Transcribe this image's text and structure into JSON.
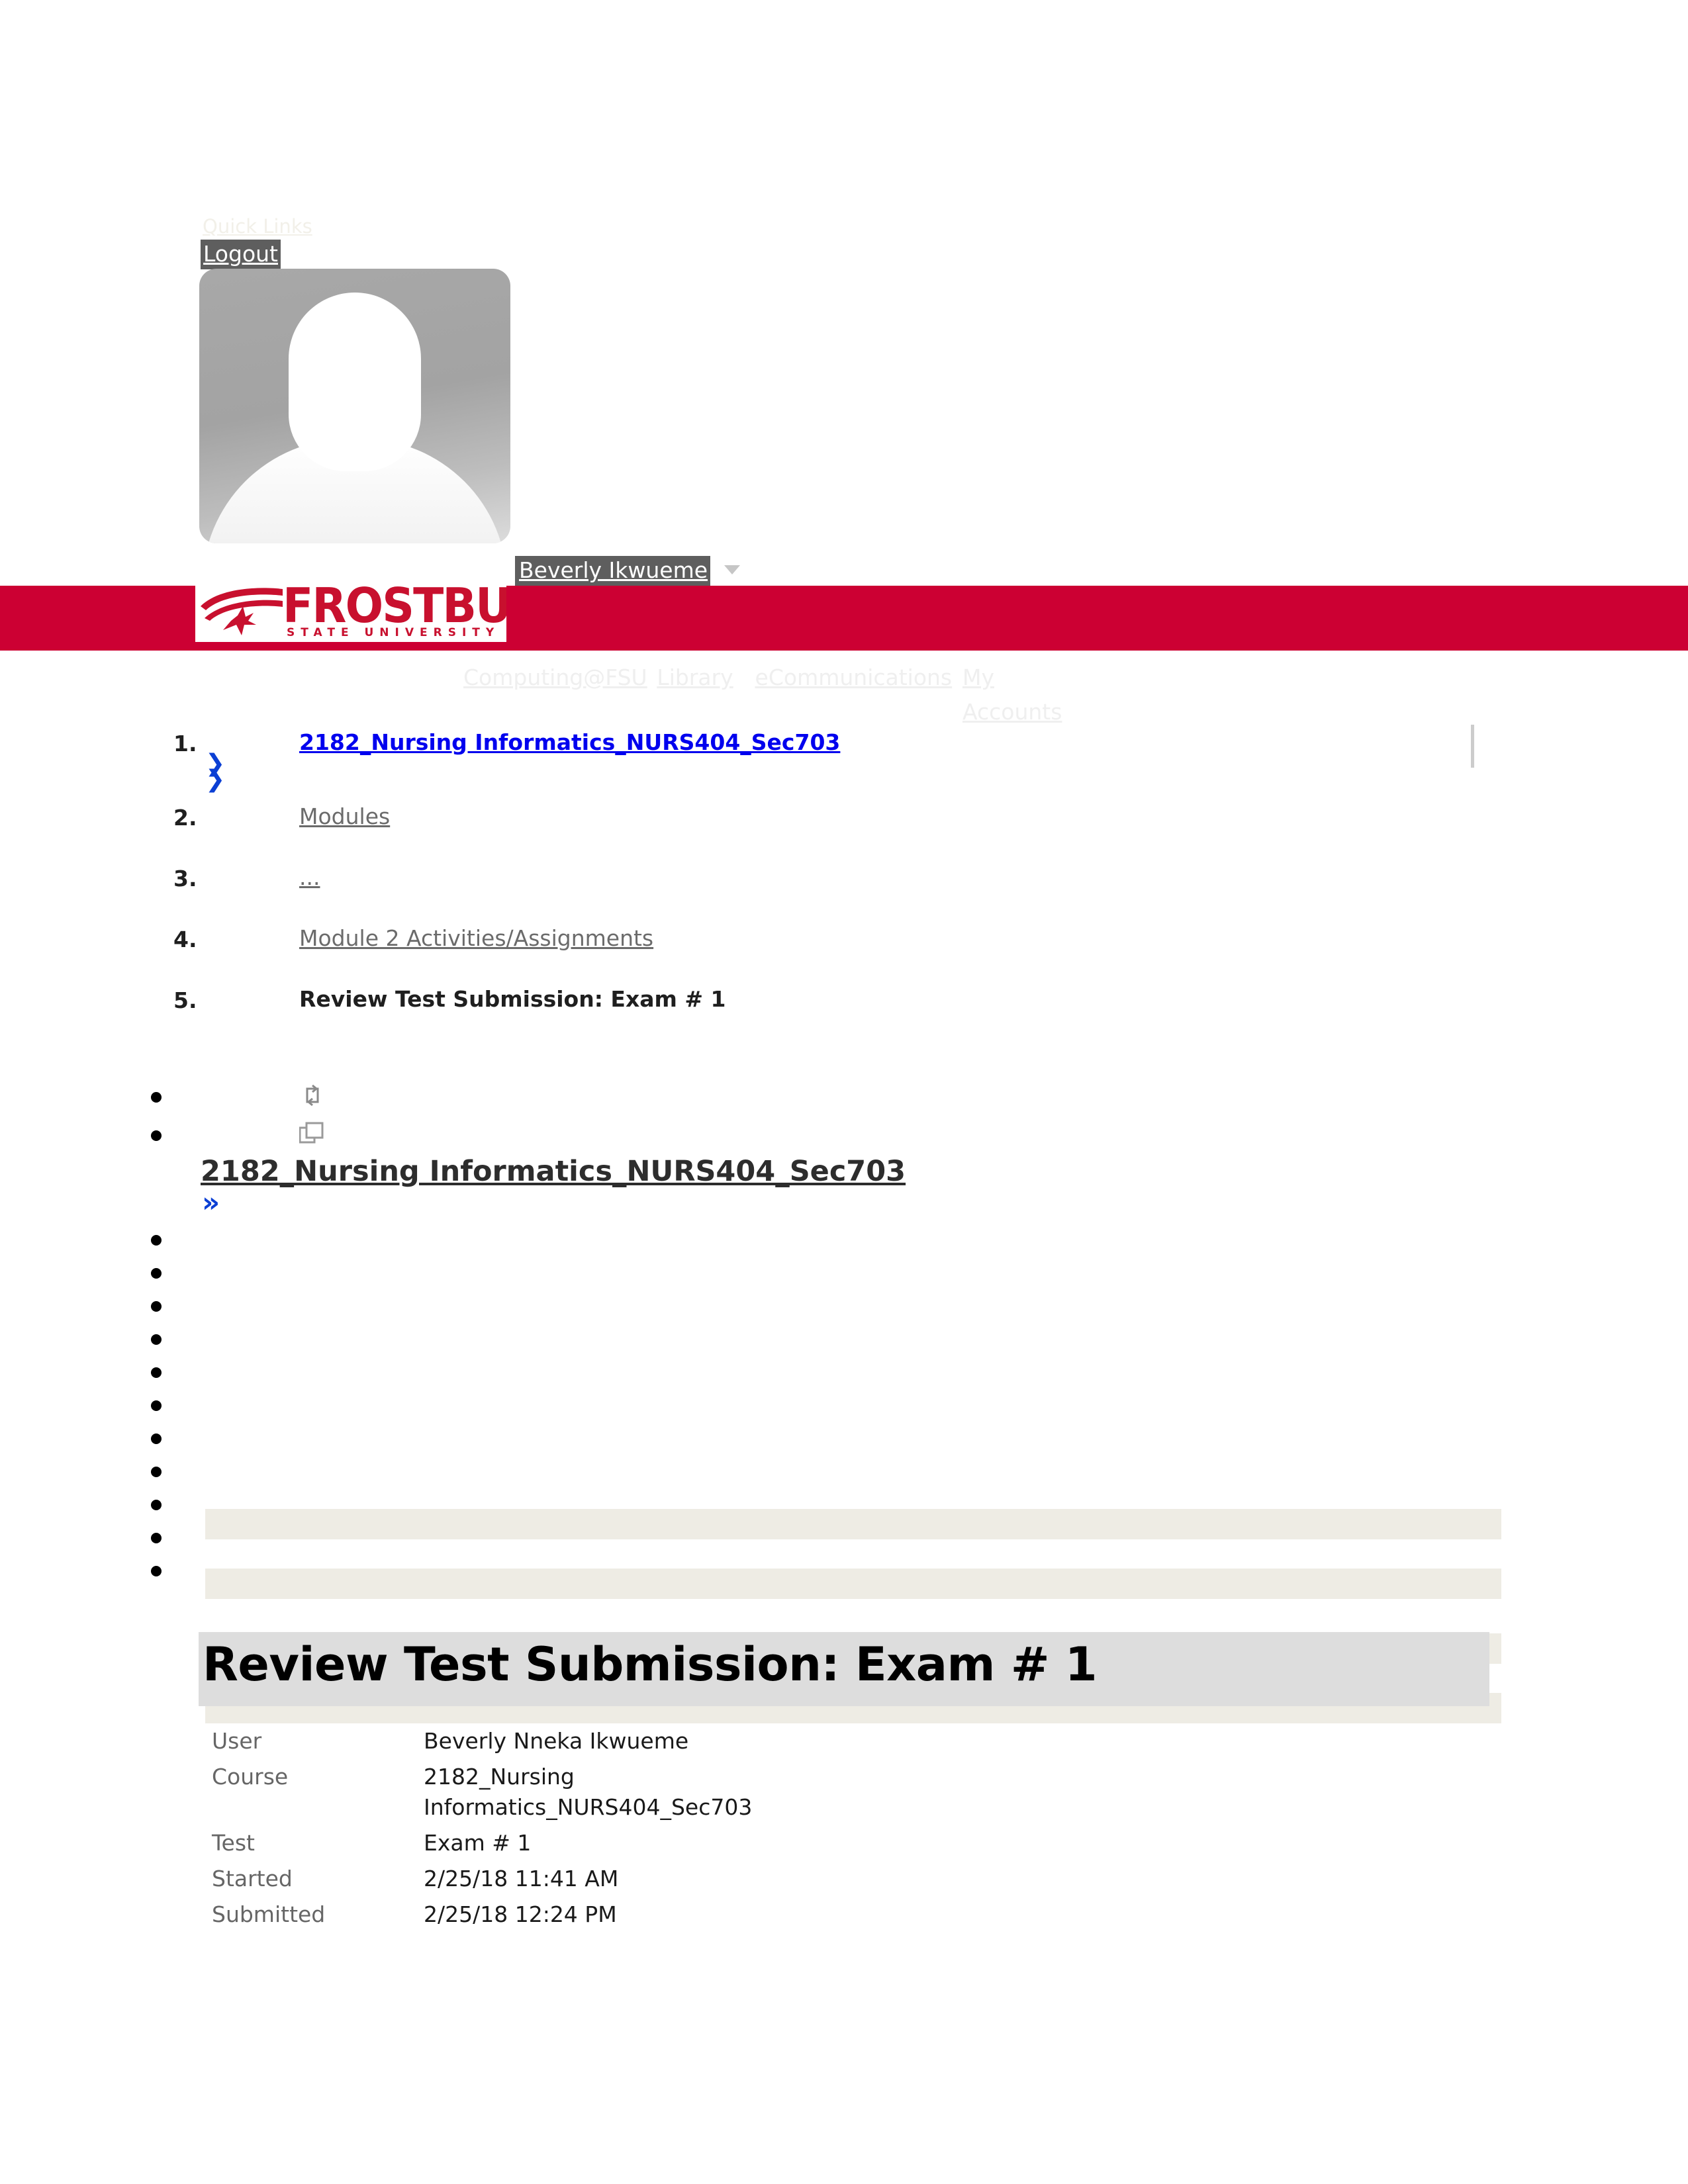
{
  "colors": {
    "brand_red": "#cc0033",
    "link_blue": "#0000ee",
    "chevron_blue": "#0b3fd4",
    "breadcrumb_sep": "#eeece4",
    "header_gray": "#dddddd",
    "pill_gray": "#5e5e5e"
  },
  "quick_links": {
    "label": "Quick Links",
    "logout_label": "Logout"
  },
  "user_menu": {
    "name": "Beverly Ikwueme",
    "caret_icon": "chevron-down-icon",
    "avatar_icon": "user-avatar-placeholder-icon"
  },
  "brand": {
    "wordmark": "FROSTBURG",
    "subwordmark": "STATE UNIVERSITY",
    "logo_icon": "frostburg-bobcat-logo-icon"
  },
  "top_nav": {
    "items": [
      {
        "label": "Computing@FSU"
      },
      {
        "label": "Library"
      },
      {
        "label": "eCommunications"
      },
      {
        "label": "My Accounts"
      }
    ]
  },
  "breadcrumb": {
    "items": [
      {
        "number": "1.",
        "label": "2182_Nursing Informatics_NURS404_Sec703",
        "style": "first"
      },
      {
        "number": "2.",
        "label": "Modules",
        "style": "link"
      },
      {
        "number": "3.",
        "label": "...",
        "style": "link"
      },
      {
        "number": "4.",
        "label": "Module 2 Activities/Assignments",
        "style": "link"
      },
      {
        "number": "5.",
        "label": "Review Test Submission: Exam # 1",
        "style": "current"
      }
    ]
  },
  "course_menu": {
    "refresh_icon": "refresh-icon",
    "detach_icon": "open-in-new-window-icon",
    "title": "2182_Nursing Informatics_NURS404_Sec703",
    "collapse_icon": "chevron-double-left-icon",
    "items": [
      {
        "label": ""
      },
      {
        "label": ""
      },
      {
        "label": ""
      },
      {
        "label": ""
      },
      {
        "label": ""
      },
      {
        "label": ""
      },
      {
        "label": ""
      },
      {
        "label": ""
      },
      {
        "label": ""
      },
      {
        "label": ""
      },
      {
        "label": ""
      }
    ]
  },
  "page": {
    "title": "Review Test Submission: Exam # 1"
  },
  "attempt": {
    "rows": [
      {
        "label": "User",
        "value": "Beverly Nneka Ikwueme"
      },
      {
        "label": "Course",
        "value": "2182_Nursing Informatics_NURS404_Sec703"
      },
      {
        "label": "Test",
        "value": "Exam # 1"
      },
      {
        "label": "Started",
        "value": "2/25/18 11:41 AM"
      },
      {
        "label": "Submitted",
        "value": "2/25/18 12:24 PM"
      }
    ]
  }
}
